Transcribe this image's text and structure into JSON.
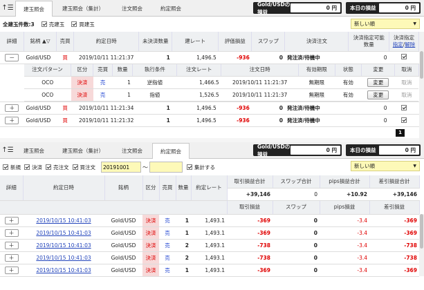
{
  "top": {
    "tabs": [
      "建玉照会",
      "建玉照会（集計）",
      "注文照会",
      "約定照会"
    ],
    "pl1_label": "Gold/USDの損益",
    "pl1_value": "0 円",
    "pl2_label": "本日の損益",
    "pl2_value": "0 円",
    "count_label": "全建玉件数:3",
    "chk1": "売建玉",
    "chk2": "買建玉",
    "sort": "新しい順",
    "headers": [
      "詳細",
      "銘柄",
      "売買",
      "約定日時",
      "未決済数量",
      "建レート",
      "評価損益",
      "スワップ",
      "決済注文",
      "決済指定可能数量",
      "決済指定"
    ],
    "hdr_link1": "指定",
    "hdr_link2": "解除",
    "rows": [
      {
        "btn": "－",
        "sym": "Gold/USD",
        "side": "買",
        "date": "2019/10/11 11:21:37",
        "qty": "1",
        "rate": "1,496.5",
        "pl": "-936",
        "swap": "0",
        "status": "発注済/待機中",
        "avail": "0"
      },
      {
        "btn": "＋",
        "sym": "Gold/USD",
        "side": "買",
        "date": "2019/10/11 11:21:34",
        "qty": "1",
        "rate": "1,496.5",
        "pl": "-936",
        "swap": "0",
        "status": "発注済/待機中",
        "avail": "0"
      },
      {
        "btn": "＋",
        "sym": "Gold/USD",
        "side": "買",
        "date": "2019/10/11 11:21:32",
        "qty": "1",
        "rate": "1,496.5",
        "pl": "-936",
        "swap": "0",
        "status": "発注済/待機中",
        "avail": "0"
      }
    ],
    "sub_headers": [
      "注文パターン",
      "区分",
      "売買",
      "数量",
      "執行条件",
      "注文レート",
      "注文日時",
      "有効期限",
      "状態",
      "変更",
      "取消"
    ],
    "sub_rows": [
      {
        "pattern": "OCO",
        "kubun": "決済",
        "side": "売",
        "qty": "1",
        "cond": "逆指値",
        "rate": "1,466.5",
        "date": "2019/10/11 11:21:37",
        "expiry": "無期限",
        "state": "有効",
        "change": "変更",
        "cancel": "取消"
      },
      {
        "pattern": "OCO",
        "kubun": "決済",
        "side": "売",
        "qty": "1",
        "cond": "指値",
        "rate": "1,526.5",
        "date": "2019/10/11 11:21:37",
        "expiry": "無期限",
        "state": "有効",
        "change": "変更",
        "cancel": "取消"
      }
    ],
    "page": "1"
  },
  "bottom": {
    "tabs": [
      "建玉照会",
      "建玉照会（集計）",
      "注文照会",
      "約定照会"
    ],
    "pl1_label": "Gold/USDの損益",
    "pl1_value": "0 円",
    "pl2_label": "本日の損益",
    "pl2_value": "0 円",
    "chks": [
      "新規",
      "決済",
      "売注文",
      "買注文"
    ],
    "date_from": "20191001",
    "tilde": "～",
    "date_to": "",
    "agg": "集計する",
    "sort": "新しい順",
    "headers": [
      "詳細",
      "約定日時",
      "銘柄",
      "区分",
      "売買",
      "数量",
      "約定レート"
    ],
    "sum_headers": [
      "取引損益合計",
      "スワップ合計",
      "pips損益合計",
      "差引損益合計"
    ],
    "sum_values": [
      "+39,146",
      "0",
      "+10.92",
      "+39,146"
    ],
    "sub_headers": [
      "取引損益",
      "スワップ",
      "pips損益",
      "差引損益"
    ],
    "rows": [
      {
        "date": "2019/10/15 10:41:03",
        "sym": "Gold/USD",
        "kubun": "決済",
        "side": "売",
        "qty": "1",
        "rate": "1,493.1",
        "pl": "-369",
        "swap": "0",
        "pips": "-3.4",
        "net": "-369"
      },
      {
        "date": "2019/10/15 10:41:03",
        "sym": "Gold/USD",
        "kubun": "決済",
        "side": "売",
        "qty": "1",
        "rate": "1,493.1",
        "pl": "-369",
        "swap": "0",
        "pips": "-3.4",
        "net": "-369"
      },
      {
        "date": "2019/10/15 10:41:03",
        "sym": "Gold/USD",
        "kubun": "決済",
        "side": "売",
        "qty": "2",
        "rate": "1,493.1",
        "pl": "-738",
        "swap": "0",
        "pips": "-3.4",
        "net": "-738"
      },
      {
        "date": "2019/10/15 10:41:03",
        "sym": "Gold/USD",
        "kubun": "決済",
        "side": "売",
        "qty": "2",
        "rate": "1,493.1",
        "pl": "-738",
        "swap": "0",
        "pips": "-3.4",
        "net": "-738"
      },
      {
        "date": "2019/10/15 10:41:03",
        "sym": "Gold/USD",
        "kubun": "決済",
        "side": "売",
        "qty": "1",
        "rate": "1,493.1",
        "pl": "-369",
        "swap": "0",
        "pips": "-3.4",
        "net": "-369"
      }
    ]
  },
  "colors": {
    "accent_red": "#e00000",
    "accent_blue": "#1a3fd0",
    "sort_bg": "#fdf9b8",
    "kubun_bg": "#f7d9d9"
  }
}
